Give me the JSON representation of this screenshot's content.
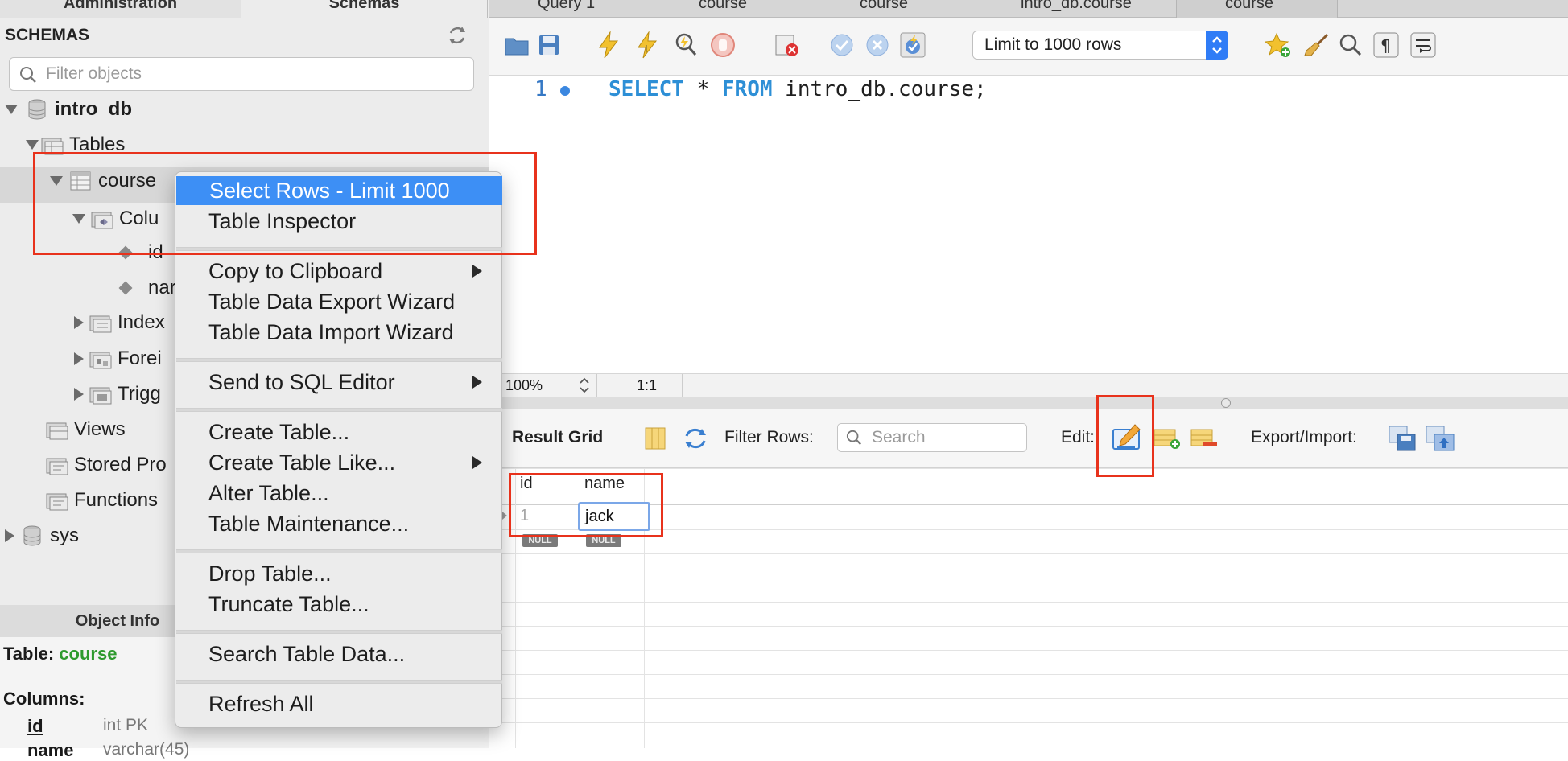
{
  "sidebar": {
    "tabs": [
      "Administration",
      "Schemas"
    ],
    "title": "SCHEMAS",
    "filter_placeholder": "Filter objects",
    "tree": {
      "db1": "intro_db",
      "tables": "Tables",
      "table": "course",
      "columns_folder": "Colu",
      "col1": "id",
      "col2": "nar",
      "indexes": "Index",
      "foreign": "Forei",
      "triggers": "Trigg",
      "views": "Views",
      "stored": "Stored Pro",
      "functions": "Functions",
      "db2": "sys"
    },
    "object_info": {
      "tab": "Object Info",
      "table_label": "Table:",
      "table_name": "course",
      "columns_label": "Columns:",
      "col1_name": "id",
      "col1_type": "int PK",
      "col2_name": "name",
      "col2_type": "varchar(45)"
    }
  },
  "query_tabs": [
    "Query 1",
    "course",
    "course",
    "intro_db.course",
    "course"
  ],
  "toolbar": {
    "limit_select": "Limit to 1000 rows"
  },
  "editor": {
    "line_number": "1",
    "sql_keyword_select": "SELECT",
    "sql_star": " * ",
    "sql_keyword_from": "FROM",
    "sql_rest": " intro_db.course;"
  },
  "status": {
    "zoom": "100%",
    "position": "1:1"
  },
  "result": {
    "grid_label": "Result Grid",
    "filter_rows_label": "Filter Rows:",
    "search_placeholder": "Search",
    "edit_label": "Edit:",
    "export_label": "Export/Import:",
    "columns": [
      "id",
      "name"
    ],
    "row1": [
      "1",
      "jack"
    ],
    "null_badge": "NULL"
  },
  "context_menu": {
    "items": [
      "Select Rows - Limit 1000",
      "Table Inspector",
      "Copy to Clipboard",
      "Table Data Export Wizard",
      "Table Data Import Wizard",
      "Send to SQL Editor",
      "Create Table...",
      "Create Table Like...",
      "Alter Table...",
      "Table Maintenance...",
      "Drop Table...",
      "Truncate Table...",
      "Search Table Data...",
      "Refresh All"
    ]
  },
  "colors": {
    "menu_highlight": "#3d8ff5",
    "annotation_red": "#e8321c",
    "sql_keyword": "#2d8fd6",
    "object_info_green": "#2e9a2e"
  }
}
